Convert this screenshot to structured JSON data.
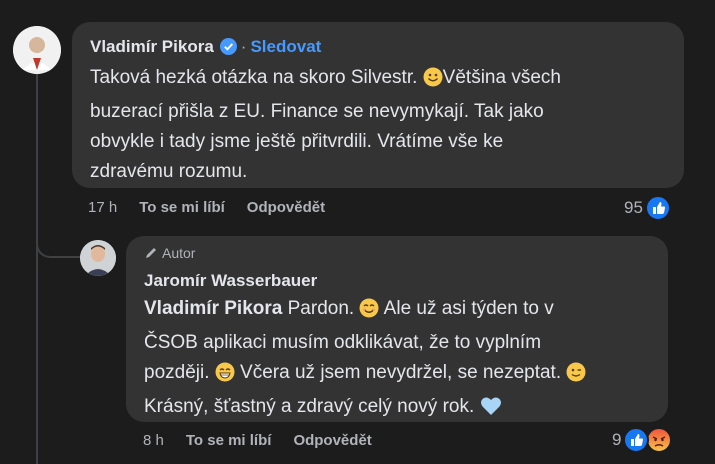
{
  "comments": [
    {
      "author": "Vladimír Pikora",
      "follow_label": "Sledovat",
      "text_lines": [
        "Taková hezká otázka na skoro Silvestr. ",
        "Většina všech",
        "buzerací přišla z EU. Finance se nevymykají. Tak jako",
        "obvykle i tady jsme ještě přitvrdili. Vrátíme vše ke",
        "zdravému rozumu."
      ],
      "time": "17 h",
      "like_label": "To se mi líbí",
      "reply_label": "Odpovědět",
      "reaction_count": "95",
      "reactions": [
        "like-icon"
      ]
    },
    {
      "badge": "Autor",
      "author": "Jaromír Wasserbauer",
      "mention": "Vladimír Pikora",
      "text_lines": [
        "Pardon. ",
        " Ale už asi týden to v",
        "ČSOB aplikaci musím odklikávat, že to vyplním",
        "později. ",
        " Včera už jsem nevydržel, se nezeptat. ",
        "Krásný, šťastný a zdravý celý nový rok. "
      ],
      "time": "8 h",
      "like_label": "To se mi líbí",
      "reply_label": "Odpovědět",
      "reaction_count": "9",
      "reactions": [
        "like-icon",
        "angry-icon"
      ]
    }
  ],
  "colors": {
    "background": "#1c1c1d",
    "bubble": "#333334",
    "link": "#4599ff",
    "like_blue": "#1877f2",
    "muted": "#b0b3b8"
  }
}
